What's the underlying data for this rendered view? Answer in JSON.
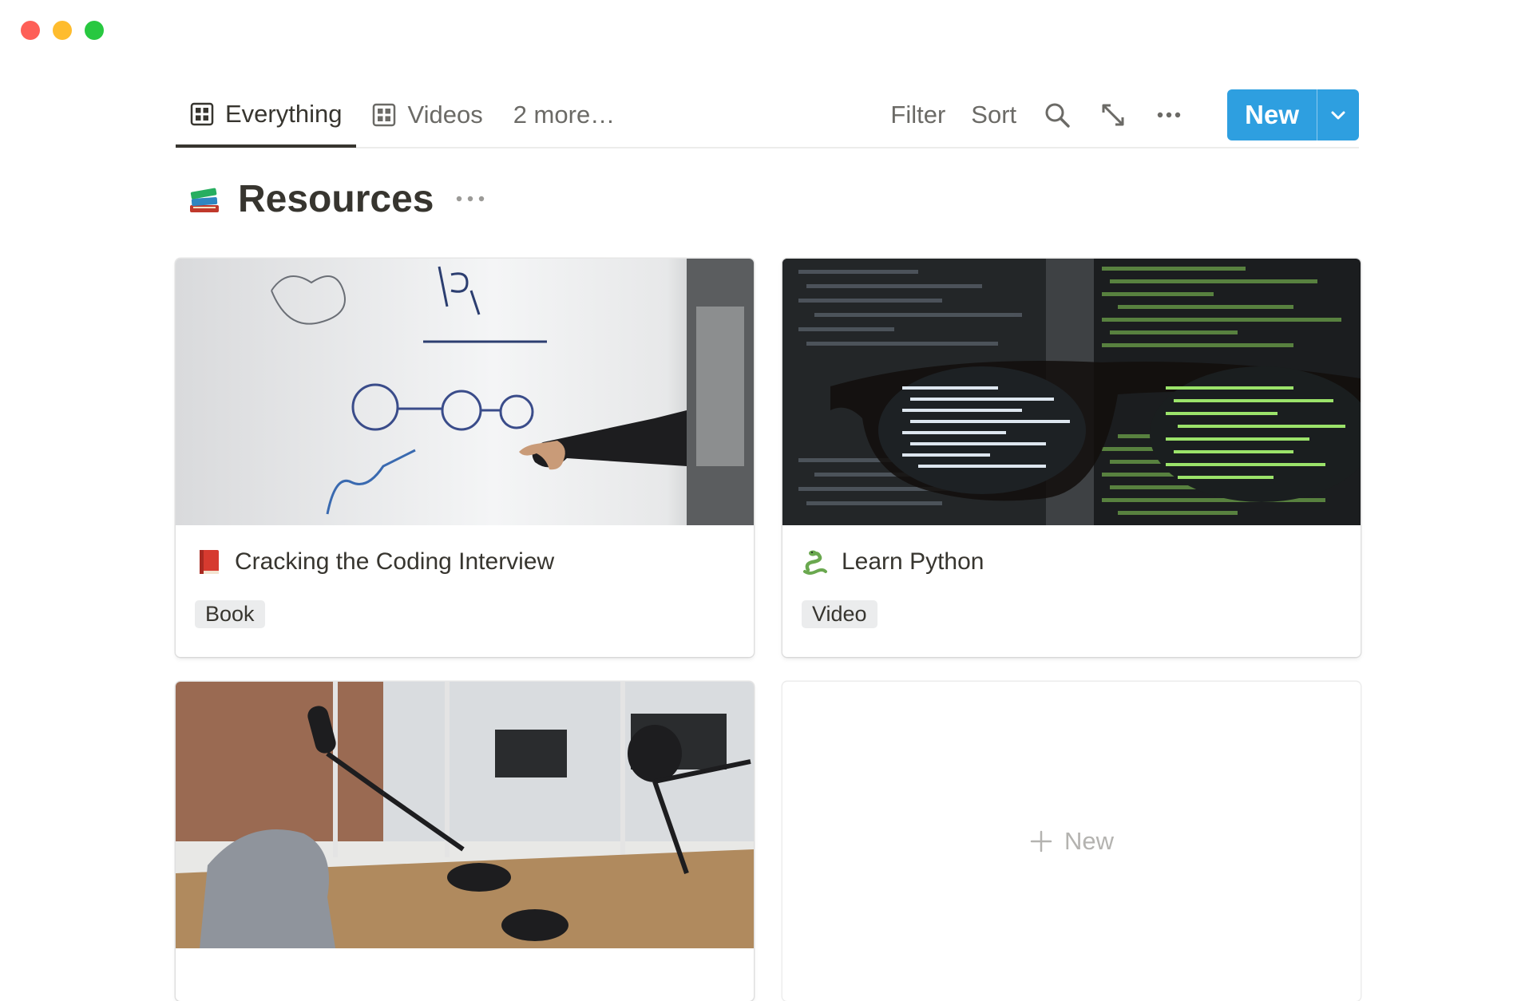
{
  "tabs": [
    {
      "label": "Everything",
      "icon": "gallery-icon",
      "active": true
    },
    {
      "label": "Videos",
      "icon": "gallery-icon",
      "active": false
    },
    {
      "label": "2 more…",
      "active": false
    }
  ],
  "toolbar": {
    "filter_label": "Filter",
    "sort_label": "Sort",
    "new_label": "New",
    "icons": [
      "search-icon",
      "expand-icon",
      "more-icon",
      "chevron-down-icon"
    ],
    "accent": "#2e9fe0"
  },
  "page": {
    "title": "Resources",
    "emoji": "books-emoji"
  },
  "cards": [
    {
      "title": "Cracking the Coding Interview",
      "emoji": "red-book-emoji",
      "tag": "Book",
      "image": "whiteboard-roadmap-photo"
    },
    {
      "title": "Learn Python",
      "emoji": "snake-emoji",
      "tag": "Video",
      "image": "code-through-glasses-photo"
    },
    {
      "image": "podcast-studio-photo"
    }
  ],
  "add_card": {
    "label": "New",
    "icon": "plus-icon"
  }
}
